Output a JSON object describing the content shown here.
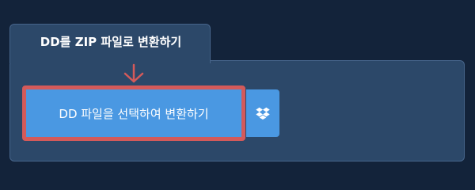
{
  "tab": {
    "title": "DD를 ZIP 파일로 변환하기"
  },
  "main_button": {
    "label": "DD 파일을 선택하여 변환하기"
  },
  "icons": {
    "arrow": "arrow-down-icon",
    "dropbox": "dropbox-icon"
  },
  "colors": {
    "page_background": "#13233a",
    "panel_background": "#2c4869",
    "button_blue": "#4a98e2",
    "highlight_red": "#d45a5a",
    "text": "#ffffff"
  }
}
